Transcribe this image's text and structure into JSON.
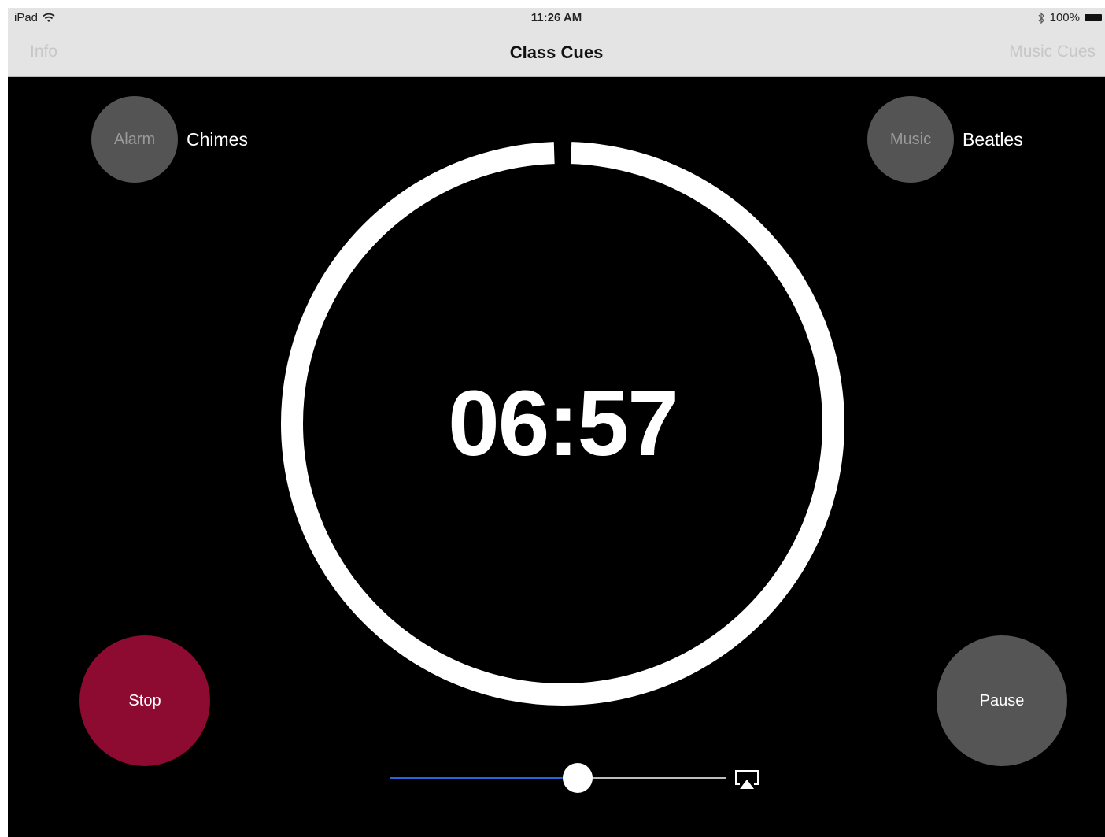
{
  "status_bar": {
    "device": "iPad",
    "time": "11:26 AM",
    "battery": "100%"
  },
  "nav": {
    "left": "Info",
    "title": "Class Cues",
    "right": "Music Cues"
  },
  "alarm": {
    "button_label": "Alarm",
    "value": "Chimes"
  },
  "music": {
    "button_label": "Music",
    "value": "Beatles"
  },
  "timer": {
    "display": "06:57",
    "progress": 0.99
  },
  "controls": {
    "stop_label": "Stop",
    "pause_label": "Pause"
  },
  "volume": {
    "level": 0.56
  },
  "colors": {
    "stop": "#8d0a30",
    "pause": "#555555",
    "slider_fill": "#2a64d8",
    "ring": "#ffffff"
  },
  "icons": {
    "wifi": "wifi-icon",
    "bluetooth": "bluetooth-icon",
    "battery": "battery-icon",
    "airplay": "airplay-icon"
  }
}
